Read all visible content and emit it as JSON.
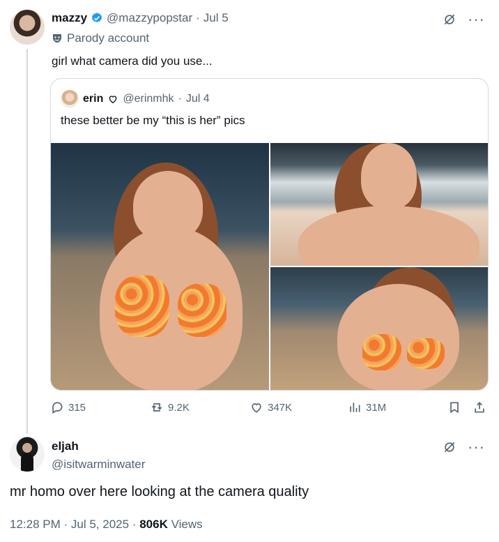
{
  "colors": {
    "text": "#0f1419",
    "secondary": "#536471",
    "border": "#cfd9de",
    "verified": "#1d9bf0"
  },
  "post": {
    "author_name": "mazzy",
    "author_handle": "@mazzypopstar",
    "date": "Jul 5",
    "account_label": "Parody account",
    "text": "girl what camera did you use...",
    "stats": {
      "replies": "315",
      "retweets": "9.2K",
      "likes": "347K",
      "views": "31M"
    }
  },
  "quote": {
    "author_name": "erin",
    "author_handle": "@erinmhk",
    "date": "Jul 4",
    "text": "these better be my “this is her” pics"
  },
  "reply": {
    "author_name": "eljah",
    "author_handle": "@isitwarminwater",
    "text": "mr homo over here looking at the camera quality",
    "time": "12:28 PM",
    "date": "Jul 5, 2025",
    "views_count": "806K",
    "views_label": "Views"
  },
  "icons": {
    "verified": "verified-badge-icon",
    "parody": "mask-icon",
    "grok": "grok-icon",
    "more": "more-icon",
    "reply": "reply-icon",
    "retweet": "retweet-icon",
    "like": "heart-icon",
    "views": "views-icon",
    "bookmark": "bookmark-icon",
    "share": "share-icon"
  }
}
